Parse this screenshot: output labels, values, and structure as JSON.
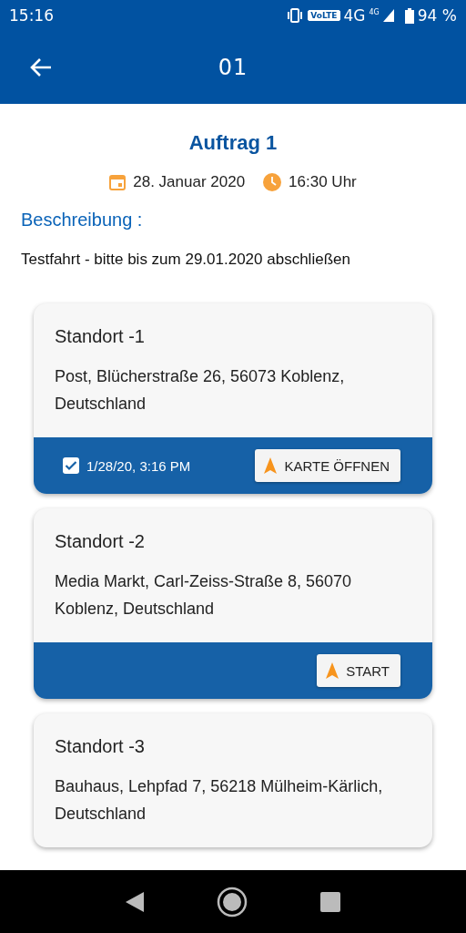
{
  "status_bar": {
    "time": "15:16",
    "volte": "VoLTE",
    "network": "4G",
    "network_small": "4G",
    "battery": "94 %"
  },
  "app_bar": {
    "title": "01"
  },
  "order": {
    "title": "Auftrag 1",
    "date": "28. Januar 2020",
    "time": "16:30 Uhr",
    "description_label": "Beschreibung :",
    "description": "Testfahrt - bitte bis zum 29.01.2020 abschließen"
  },
  "locations": [
    {
      "title": "Standort -1",
      "address": "Post, Blücherstraße 26, 56073 Koblenz, Deutschland",
      "footer": {
        "checked": true,
        "done_time": "1/28/20, 3:16 PM",
        "button": "KARTE ÖFFNEN"
      }
    },
    {
      "title": "Standort -2",
      "address": "Media Markt, Carl-Zeiss-Straße 8, 56070 Koblenz, Deutschland",
      "footer": {
        "checked": false,
        "button": "START"
      }
    },
    {
      "title": "Standort -3",
      "address": "Bauhaus, Lehpfad 7, 56218 Mülheim-Kärlich, Deutschland"
    }
  ]
}
